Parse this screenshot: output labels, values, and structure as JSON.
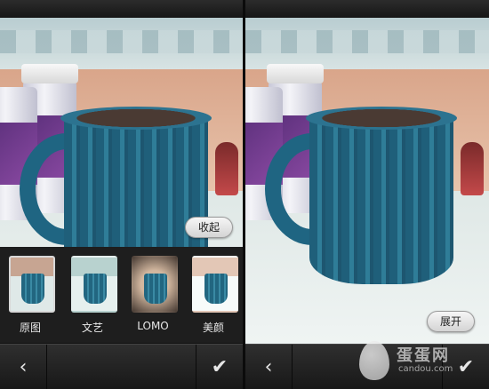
{
  "left_panel": {
    "collapse_button": "收起",
    "filters": [
      {
        "label": "原图",
        "selected": true
      },
      {
        "label": "文艺",
        "selected": false
      },
      {
        "label": "LOMO",
        "selected": false
      },
      {
        "label": "美颜",
        "selected": false
      }
    ],
    "back_icon": "chevron-left-icon",
    "confirm_icon": "checkmark-icon"
  },
  "right_panel": {
    "expand_button": "展开",
    "back_icon": "chevron-left-icon",
    "confirm_icon": "checkmark-icon"
  },
  "watermark": {
    "brand": "蛋蛋网",
    "url": "candou.com"
  },
  "colors": {
    "bar_dark": "#1c1c1c",
    "mug_teal": "#2f7d98",
    "pill_light": "#f0f0f0"
  }
}
